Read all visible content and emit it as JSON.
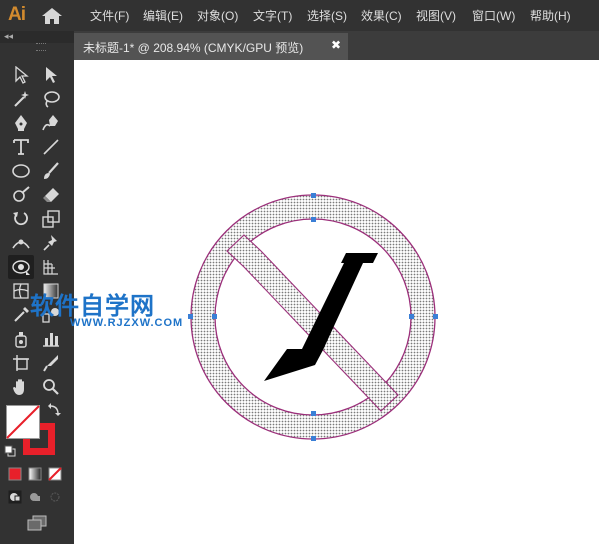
{
  "app": {
    "logo": "Ai"
  },
  "menu": {
    "items": [
      "文件(F)",
      "编辑(E)",
      "对象(O)",
      "文字(T)",
      "选择(S)",
      "效果(C)",
      "视图(V)",
      "窗口(W)",
      "帮助(H)"
    ]
  },
  "document": {
    "tab_label": "未标题-1* @ 208.94% (CMYK/GPU 预览)",
    "close_glyph": "✖"
  },
  "toolbar": {
    "collapse_glyph": "◂◂",
    "tools": [
      "selection",
      "direct-selection",
      "magic-wand",
      "lasso",
      "pen",
      "curvature",
      "type",
      "line-segment",
      "ellipse",
      "paintbrush",
      "shaper",
      "eraser",
      "rotate",
      "scale",
      "width",
      "puppet-warp",
      "free-transform",
      "perspective-grid",
      "mesh",
      "gradient",
      "eyedropper",
      "blend",
      "symbol-sprayer",
      "column-graph",
      "artboard",
      "slice",
      "hand",
      "zoom"
    ],
    "fill_color": "#ffffff",
    "stroke_color": "#e8202a"
  },
  "watermark": {
    "main": "软件自学网",
    "sub": "WWW.RJZXW.COM"
  },
  "artwork": {
    "ring_fill": "#d4d4d4",
    "ring_stroke": "#9b2f7a",
    "anchor_color": "#3a7fd6",
    "glyph": "/",
    "glyph_color": "#000000"
  }
}
